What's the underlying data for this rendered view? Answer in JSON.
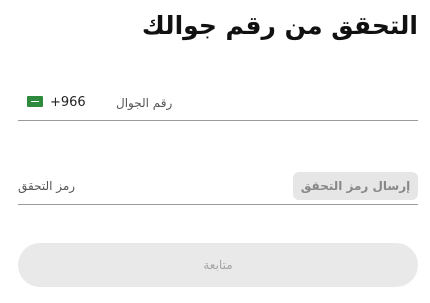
{
  "page": {
    "title": "التحقق من رقم جوالك"
  },
  "phone_field": {
    "label": "رقم الجوال",
    "country_code": "+966",
    "flag_icon": "saudi-flag-icon"
  },
  "code_field": {
    "label": "رمز التحقق",
    "send_button_label": "إرسال رمز التحقق"
  },
  "actions": {
    "continue_label": "متابعة"
  },
  "colors": {
    "button_bg_disabled": "#e9e9e9",
    "button_text_disabled": "#a5a5a5",
    "flag_green": "#2e8b3e",
    "underline": "#9a9a9a"
  }
}
